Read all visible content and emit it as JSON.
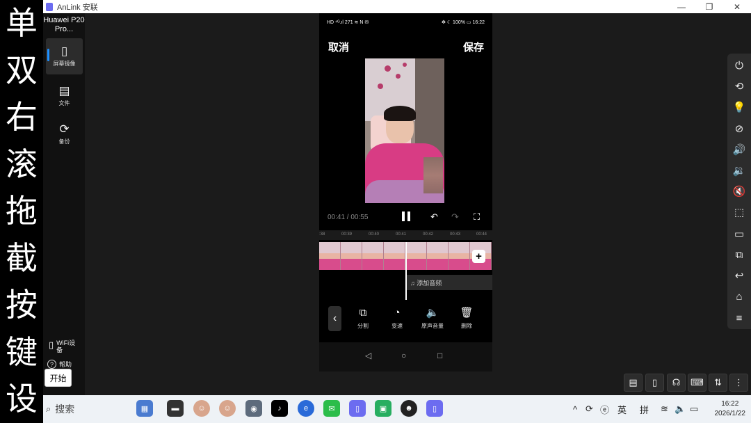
{
  "overlay": {
    "chars": [
      "单",
      "双",
      "右",
      "滚",
      "拖",
      "截",
      "按",
      "键",
      "设"
    ]
  },
  "titlebar": {
    "title": "AnLink 安联",
    "minimize": "—",
    "restore": "❐",
    "close": "✕"
  },
  "sidebar": {
    "device_name": "Huawei P20 Pro...",
    "items": [
      {
        "label": "屏幕镜像",
        "icon": "▯"
      },
      {
        "label": "文件",
        "icon": "▤"
      },
      {
        "label": "备份",
        "icon": "⟳"
      }
    ],
    "wifi_label": "WiFi设备",
    "help_label": "帮助"
  },
  "tooltip": "开始",
  "phone": {
    "status_left": "HD ⁴ᴳ.ıl 271 ≋ N ✉",
    "status_right": "✻ ☾ 100% ▭ 16:22",
    "cancel": "取消",
    "save": "保存",
    "time": "00:41 / 00:55",
    "timeline_ticks": [
      ":38",
      "00:39",
      "00:40",
      "00:41",
      "00:42",
      "00:43",
      "00:44"
    ],
    "add_audio": "♫ 添加音频",
    "tools": [
      {
        "label": "分割",
        "icon": "⧉"
      },
      {
        "label": "变速",
        "icon": "◔"
      },
      {
        "label": "原声音量",
        "icon": "🔈"
      },
      {
        "label": "删除",
        "icon": "🗑"
      }
    ]
  },
  "right_toolbar": [
    "⏻",
    "⟲",
    "💡",
    "⊘",
    "🔊",
    "🔉",
    "🔇",
    "⬚",
    "▭",
    "⧉",
    "↩",
    "⌂",
    "≡"
  ],
  "bottom_buttons": [
    "▤",
    "▯",
    "☊",
    "⌨",
    "⇅",
    "⋮"
  ],
  "taskbar": {
    "search_placeholder": "搜索",
    "tray_ime_1": "英",
    "tray_ime_2": "拼",
    "time": "16:22",
    "date": "2026/1/22"
  }
}
